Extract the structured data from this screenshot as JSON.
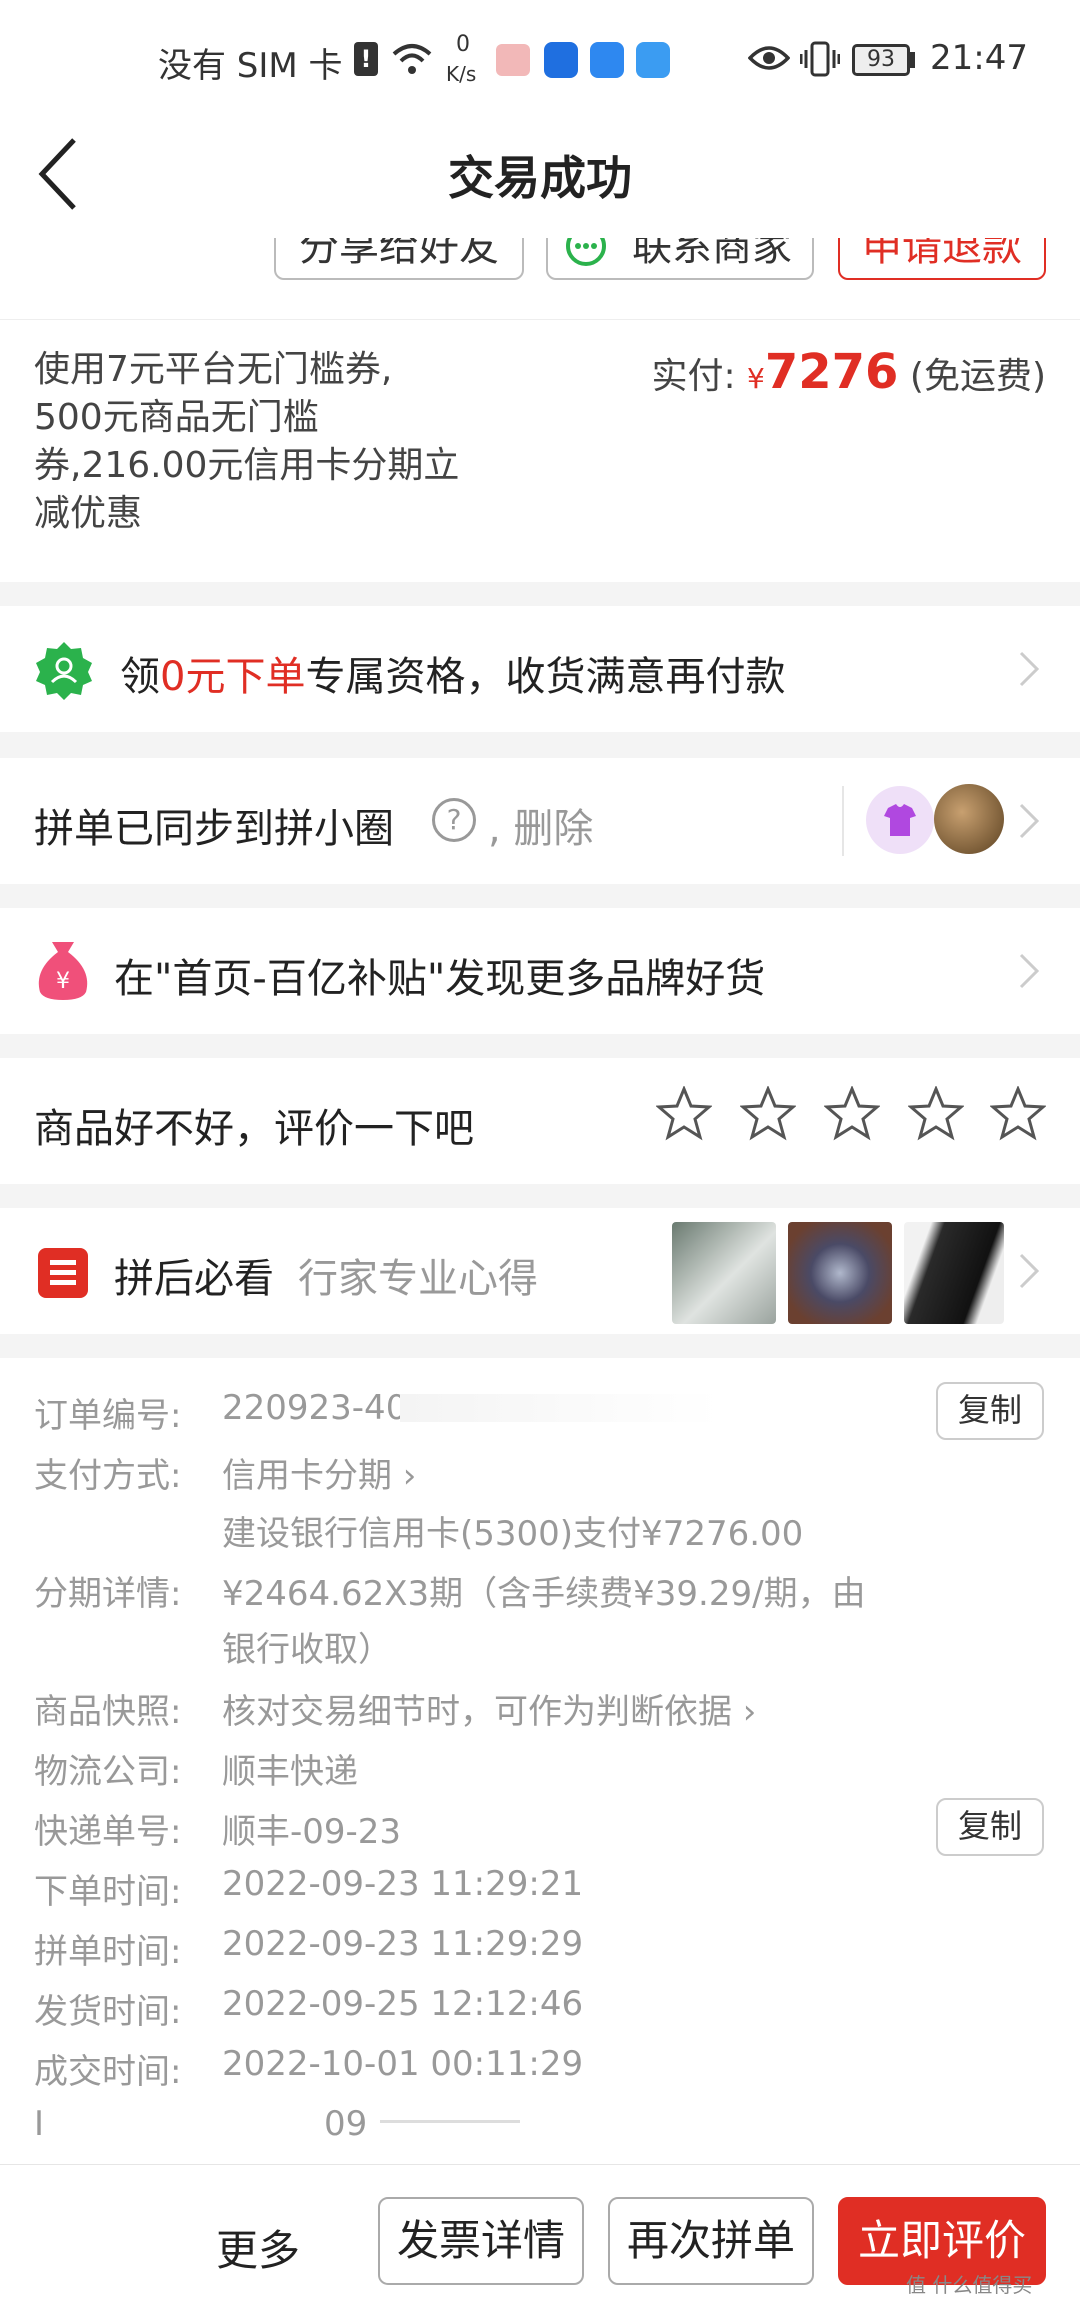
{
  "status_bar": {
    "carrier": "没有 SIM 卡",
    "speed_value": "0",
    "speed_unit": "K/s",
    "battery": "93",
    "time": "21:47"
  },
  "header": {
    "title": "交易成功"
  },
  "actions": {
    "share": "分享给好友",
    "contact": "联系商家",
    "refund": "申请退款"
  },
  "payment": {
    "coupon_lines": [
      "使用7元平台无门槛券,",
      "500元商品无门槛",
      "券,216.00元信用卡分期立",
      "减优惠"
    ],
    "paid_label": "实付:",
    "currency": "¥",
    "amount": "7276",
    "shipping": "(免运费)"
  },
  "promo": {
    "prefix": "领",
    "highlight": "0元下单",
    "suffix": "专属资格，收货满意再付款"
  },
  "group": {
    "text": "拼单已同步到拼小圈",
    "help": "?",
    "delete": ", 删除"
  },
  "subsidy": {
    "text": "在\"首页-百亿补贴\"发现更多品牌好货"
  },
  "rating": {
    "prompt": "商品好不好，评价一下吧",
    "stars": 5,
    "rating_value": 0
  },
  "guide": {
    "title": "拼后必看",
    "subtitle": "行家专业心得"
  },
  "order_info": {
    "order_no_label": "订单编号:",
    "order_no": "220923-40",
    "copy": "复制",
    "pay_label": "支付方式:",
    "pay_method": "信用卡分期 ›",
    "pay_detail": "建设银行信用卡(5300)支付¥7276.00",
    "installment_label": "分期详情:",
    "installment_line1": "¥2464.62X3期（含手续费¥39.29/期，由",
    "installment_line2": "银行收取）",
    "snapshot_label": "商品快照:",
    "snapshot": "核对交易细节时，可作为判断依据 ›",
    "logistics_label": "物流公司:",
    "logistics": "顺丰快递",
    "tracking_label": "快递单号:",
    "tracking": "顺丰-09-23",
    "order_time_label": "下单时间:",
    "order_time": "2022-09-23 11:29:21",
    "group_time_label": "拼单时间:",
    "group_time": "2022-09-23 11:29:29",
    "ship_time_label": "发货时间:",
    "ship_time": "2022-09-25 12:12:46",
    "deal_time_label": "成交时间:",
    "deal_time": "2022-10-01 00:11:29",
    "extra_label": "I",
    "extra": "09"
  },
  "bottom": {
    "more": "更多",
    "invoice": "发票详情",
    "regroup": "再次拼单",
    "review": "立即评价"
  },
  "watermark": "值 什么值得买",
  "colors": {
    "accent": "#e02e24",
    "promo_green": "#2bb24c",
    "pink": "#f0507a"
  }
}
